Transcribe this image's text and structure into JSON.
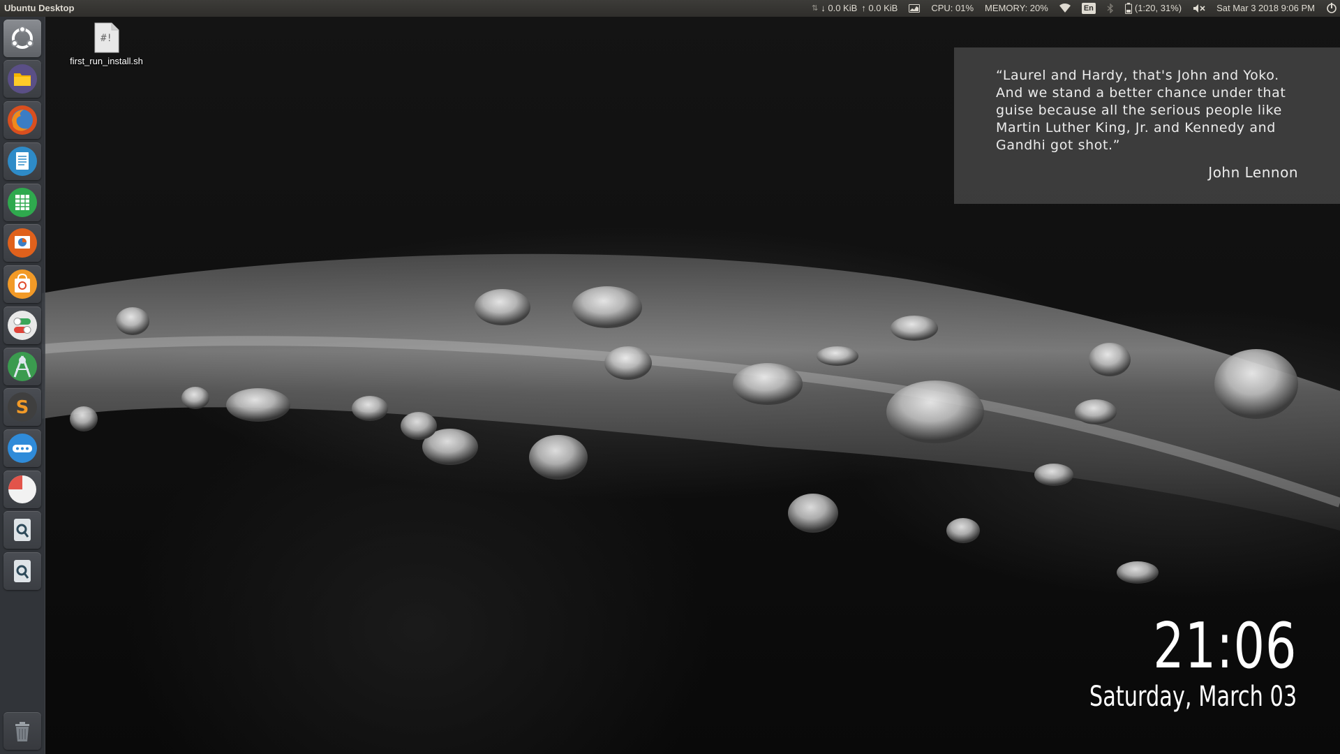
{
  "panel": {
    "window_title": "Ubuntu Desktop",
    "network_down": "↓ 0.0 KiB",
    "network_up": "↑ 0.0 KiB",
    "cpu": "CPU: 01%",
    "memory": "MEMORY: 20%",
    "keyboard_layout": "En",
    "battery": "(1:20, 31%)",
    "datetime": "Sat Mar  3 2018  9:06 PM"
  },
  "launcher": {
    "items": [
      {
        "name": "dash-home",
        "icon": "ubuntu-logo-icon"
      },
      {
        "name": "files",
        "icon": "folder-icon"
      },
      {
        "name": "firefox",
        "icon": "firefox-icon"
      },
      {
        "name": "libreoffice-writer",
        "icon": "writer-document-icon"
      },
      {
        "name": "libreoffice-calc",
        "icon": "calc-spreadsheet-icon"
      },
      {
        "name": "libreoffice-impress",
        "icon": "impress-presentation-icon"
      },
      {
        "name": "ubuntu-software",
        "icon": "software-center-icon"
      },
      {
        "name": "system-settings",
        "icon": "settings-toggle-icon"
      },
      {
        "name": "android-studio",
        "icon": "android-studio-icon"
      },
      {
        "name": "sublime-text",
        "icon": "sublime-s-icon"
      },
      {
        "name": "messaging",
        "icon": "chat-bubble-icon"
      },
      {
        "name": "disk-usage",
        "icon": "pie-chart-icon"
      },
      {
        "name": "qt-creator-1",
        "icon": "qt-q-icon"
      },
      {
        "name": "qt-creator-2",
        "icon": "qt-q-icon"
      },
      {
        "name": "trash",
        "icon": "trash-icon"
      }
    ]
  },
  "desktop": {
    "file_label": "first_run_install.sh",
    "file_glyph": "#!"
  },
  "quote": {
    "text": "“Laurel and Hardy, that's John and Yoko. And we stand a better chance under that guise because all the serious people like Martin Luther King, Jr. and Kennedy and Gandhi got shot.”",
    "author": "John Lennon"
  },
  "clock": {
    "time": "21:06",
    "date": "Saturday, March 03"
  }
}
